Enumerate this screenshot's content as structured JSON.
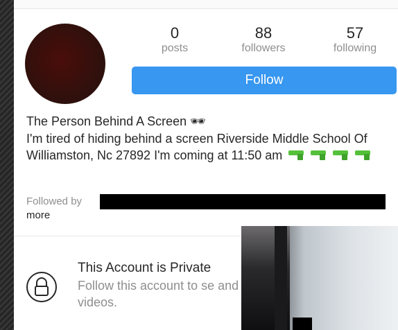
{
  "profile": {
    "stats": [
      {
        "value": "0",
        "label": "posts"
      },
      {
        "value": "88",
        "label": "followers"
      },
      {
        "value": "57",
        "label": "following"
      }
    ],
    "follow_label": "Follow",
    "name": "The Person Behind A Screen 🕶",
    "bio": "I'm tired of hiding behind a screen Riverside Middle School Of Williamston, Nc 27892 I'm coming at 11:50 am",
    "bio_emoji": "water-pistol-icon x4",
    "followed_by_label": "Followed by",
    "more_label": "more"
  },
  "private": {
    "title": "This Account is Private",
    "subtitle": "Follow this account to se and videos."
  },
  "colors": {
    "accent": "#3897f0",
    "text": "#262626",
    "muted": "#8e8e8e"
  }
}
